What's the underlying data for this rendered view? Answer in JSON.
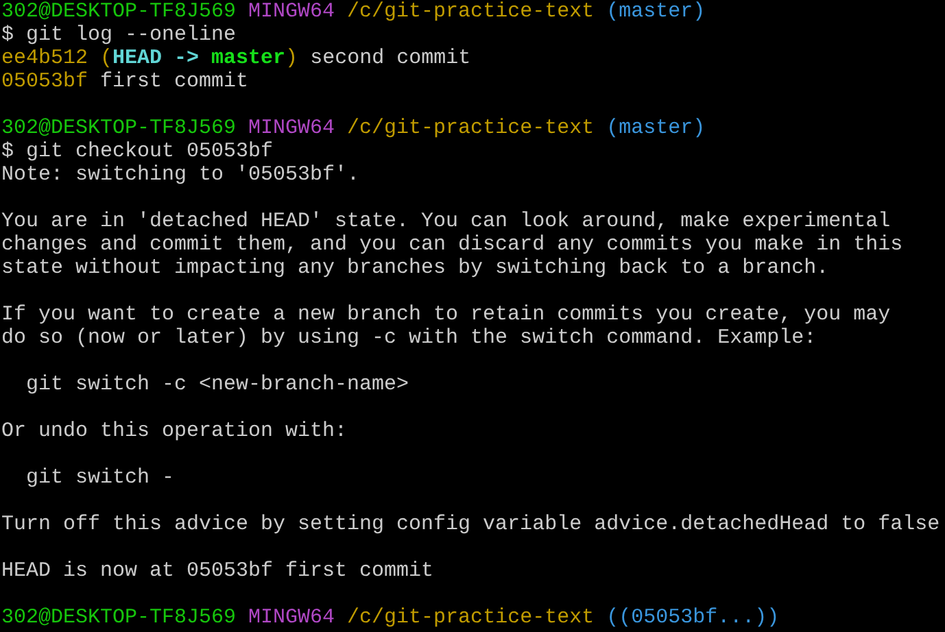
{
  "terminal": {
    "blocks": [
      {
        "lines": [
          [
            {
              "text": "302@DESKTOP-TF8J569 ",
              "color": "#16c60c"
            },
            {
              "text": "MINGW64 ",
              "color": "#b148c6"
            },
            {
              "text": "/c/git-practice-text ",
              "color": "#c19c00"
            },
            {
              "text": "(master)",
              "color": "#3a96dd"
            }
          ],
          [
            {
              "text": "$ git log --oneline",
              "color": "#cccccc"
            }
          ],
          [
            {
              "text": "ee4b512 (",
              "color": "#c19c00"
            },
            {
              "text": "HEAD -> ",
              "color": "#61d6d6",
              "bold": true
            },
            {
              "text": "master",
              "color": "#16e01a",
              "bold": true
            },
            {
              "text": ")",
              "color": "#c19c00"
            },
            {
              "text": " second commit",
              "color": "#cccccc"
            }
          ],
          [
            {
              "text": "05053bf",
              "color": "#c19c00"
            },
            {
              "text": " first commit",
              "color": "#cccccc"
            }
          ]
        ]
      },
      {
        "lines": [
          [
            {
              "text": "302@DESKTOP-TF8J569 ",
              "color": "#16c60c"
            },
            {
              "text": "MINGW64 ",
              "color": "#b148c6"
            },
            {
              "text": "/c/git-practice-text ",
              "color": "#c19c00"
            },
            {
              "text": "(master)",
              "color": "#3a96dd"
            }
          ],
          [
            {
              "text": "$ git checkout 05053bf",
              "color": "#cccccc"
            }
          ],
          [
            {
              "text": "Note: switching to '05053bf'.",
              "color": "#cccccc"
            }
          ]
        ]
      },
      {
        "lines": [
          [
            {
              "text": "You are in 'detached HEAD' state. You can look around, make experimental",
              "color": "#cccccc"
            }
          ],
          [
            {
              "text": "changes and commit them, and you can discard any commits you make in this",
              "color": "#cccccc"
            }
          ],
          [
            {
              "text": "state without impacting any branches by switching back to a branch.",
              "color": "#cccccc"
            }
          ]
        ]
      },
      {
        "lines": [
          [
            {
              "text": "If you want to create a new branch to retain commits you create, you may",
              "color": "#cccccc"
            }
          ],
          [
            {
              "text": "do so (now or later) by using -c with the switch command. Example:",
              "color": "#cccccc"
            }
          ]
        ]
      },
      {
        "lines": [
          [
            {
              "text": "  git switch -c <new-branch-name>",
              "color": "#cccccc"
            }
          ]
        ]
      },
      {
        "lines": [
          [
            {
              "text": "Or undo this operation with:",
              "color": "#cccccc"
            }
          ]
        ]
      },
      {
        "lines": [
          [
            {
              "text": "  git switch -",
              "color": "#cccccc"
            }
          ]
        ]
      },
      {
        "lines": [
          [
            {
              "text": "Turn off this advice by setting config variable advice.detachedHead to false",
              "color": "#cccccc"
            }
          ]
        ]
      },
      {
        "lines": [
          [
            {
              "text": "HEAD is now at 05053bf first commit",
              "color": "#cccccc"
            }
          ]
        ]
      },
      {
        "lines": [
          [
            {
              "text": "302@DESKTOP-TF8J569 ",
              "color": "#16c60c"
            },
            {
              "text": "MINGW64 ",
              "color": "#b148c6"
            },
            {
              "text": "/c/git-practice-text ",
              "color": "#c19c00"
            },
            {
              "text": "((05053bf...))",
              "color": "#3a96dd"
            }
          ]
        ]
      }
    ]
  }
}
